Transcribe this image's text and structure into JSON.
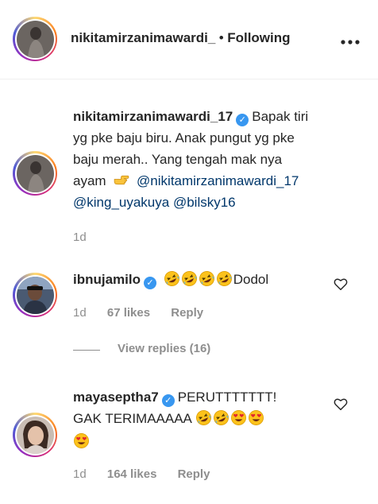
{
  "header": {
    "username": "nikitamirzanimawardi_",
    "separator": "•",
    "following": "Following",
    "more_icon": "more-horizontal-icon"
  },
  "caption": {
    "username": "nikitamirzanimawardi_17",
    "line1": "Bapak tiri",
    "line2": "yg pke baju biru. Anak pungut yg pke",
    "line3": "baju merah.. Yang tengah mak nya",
    "line4_text": "ayam",
    "mention1": "@nikitamirzanimawardi_17",
    "mention2": "@king_uyakuya",
    "mention3": "@bilsky16",
    "time": "1d"
  },
  "comments": [
    {
      "username": "ibnujamilo",
      "text": "Dodol",
      "time": "1d",
      "likes": "67 likes",
      "reply": "Reply"
    },
    {
      "username": "mayaseptha7",
      "text_line1": "PERUTTTTTTT!",
      "text_line2": "GAK TERIMAAAAA",
      "time": "1d",
      "likes": "164 likes",
      "reply": "Reply"
    }
  ],
  "view_replies": "View replies (16)",
  "colors": {
    "mention": "#00376b",
    "verified": "#3897f0",
    "meta": "#8e8e8e"
  }
}
